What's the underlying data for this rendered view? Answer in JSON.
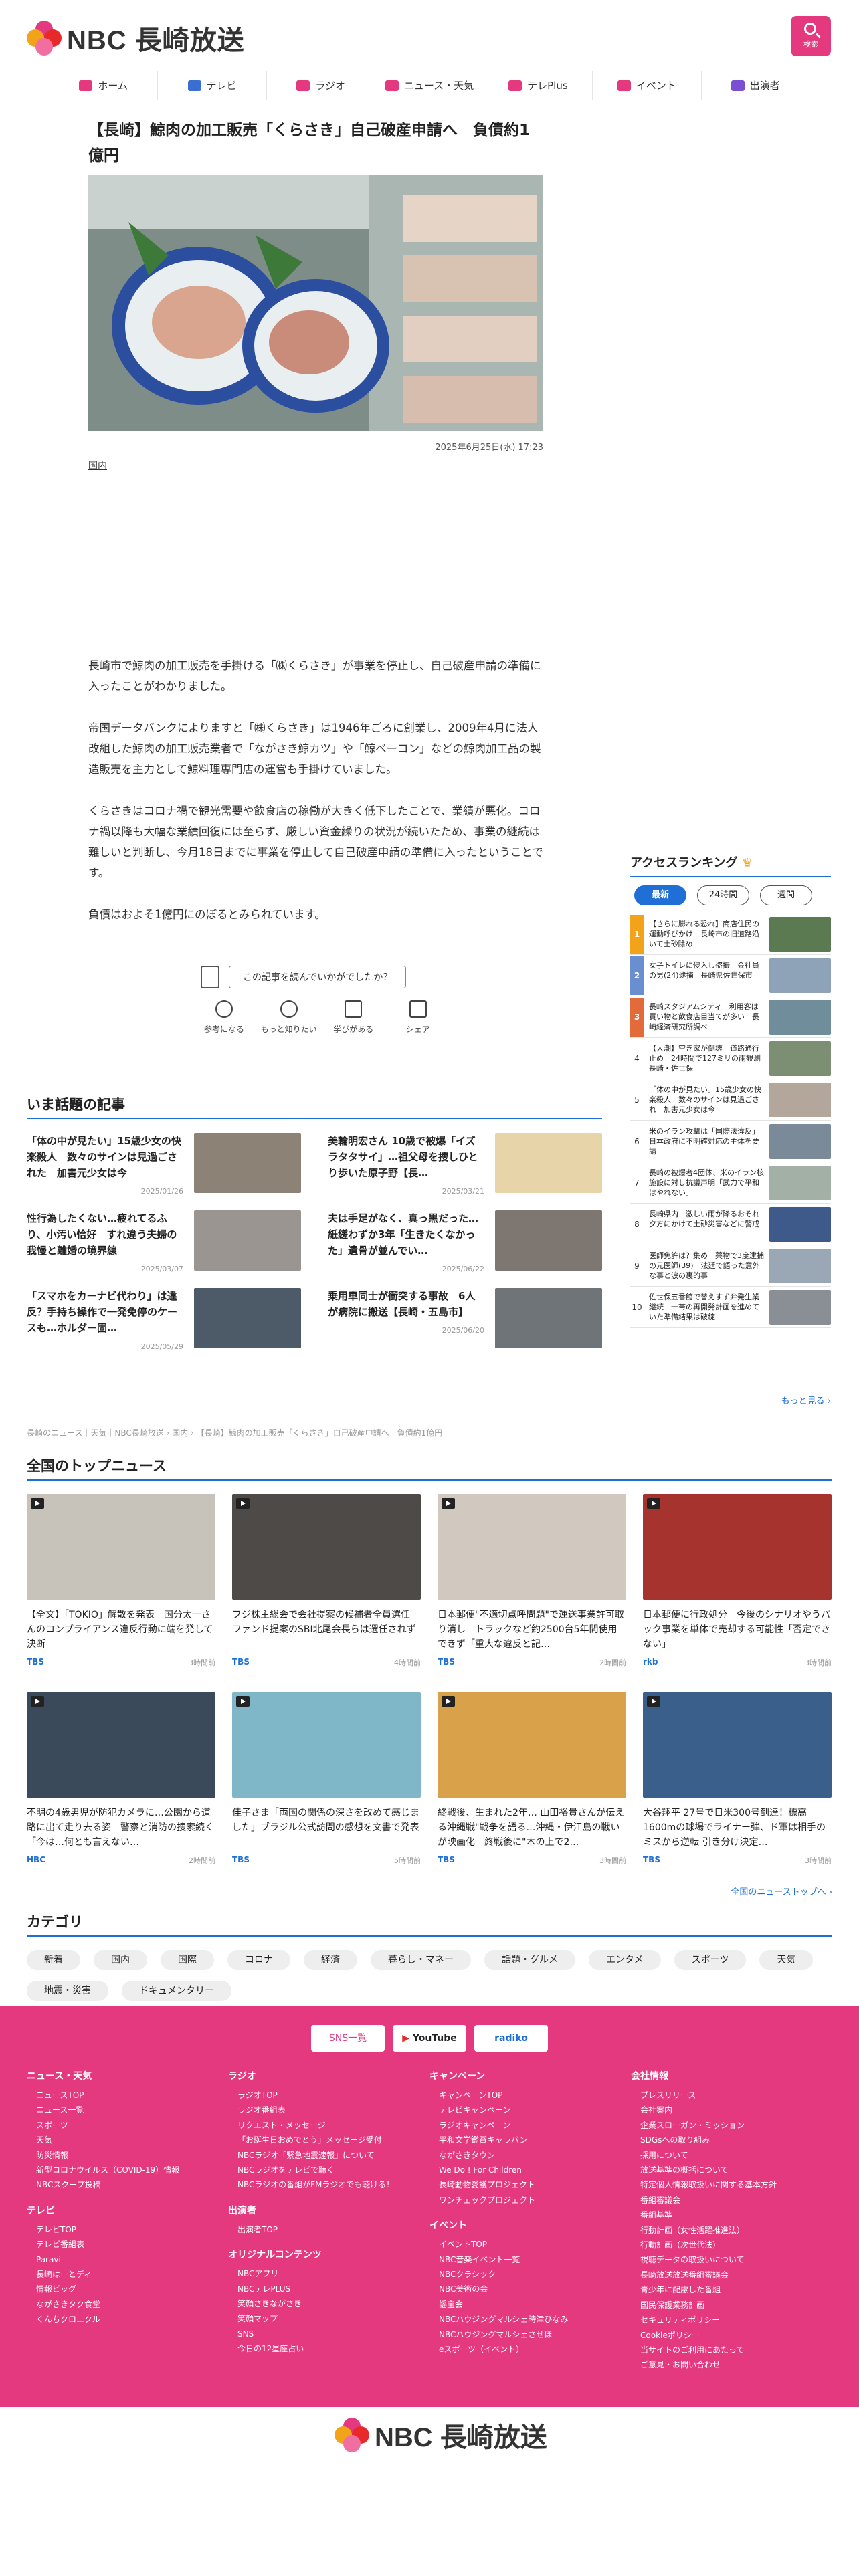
{
  "site": {
    "name": "NBC 長崎放送",
    "search_label": "検索"
  },
  "nav": [
    "ホーム",
    "テレビ",
    "ラジオ",
    "ニュース・天気",
    "テレPlus",
    "イベント",
    "出演者"
  ],
  "article": {
    "title": "【長崎】鯨肉の加工販売「くらさき」自己破産申請へ　負債約1億円",
    "date": "2025年6月25日(水) 17:23",
    "category": "国内",
    "paragraphs": [
      "長崎市で鯨肉の加工販売を手掛ける「㈱くらさき」が事業を停止し、自己破産申請の準備に入ったことがわかりました。",
      "帝国データバンクによりますと「㈱くらさき」は1946年ごろに創業し、2009年4月に法人改組した鯨肉の加工販売業者で「ながさき鯨カツ」や「鯨ベーコン」などの鯨肉加工品の製造販売を主力として鯨料理専門店の運営も手掛けていました。",
      "くらさきはコロナ禍で観光需要や飲食店の稼働が大きく低下したことで、業績が悪化。コロナ禍以降も大幅な業績回復には至らず、厳しい資金繰りの状況が続いたため、事業の継続は難しいと判断し、今月18日までに事業を停止して自己破産申請の準備に入ったということです。",
      "負債はおよそ1億円にのぼるとみられています。"
    ],
    "reaction_question": "この記事を読んでいかがでしたか？",
    "reactions": [
      "参考になる",
      "もっと知りたい",
      "学びがある",
      "シェア"
    ]
  },
  "ranking": {
    "title": "アクセスランキング",
    "tabs": [
      "最新",
      "24時間",
      "週間"
    ],
    "items": [
      {
        "n": "1",
        "text": "【さらに膨れる恐れ】商店住民の運動呼びかけ　長崎市の旧道路沿いて土砂除め"
      },
      {
        "n": "2",
        "text": "女子トイレに侵入し盗撮　会社員の男(24)逮捕　長崎県佐世保市"
      },
      {
        "n": "3",
        "text": "長崎スタジアムシティ　利用客は買い物と飲食店目当てが多い　長崎経済研究所調べ"
      },
      {
        "n": "4",
        "text": "【大潮】空き家が倒壊　道路通行止め　24時間で127ミリの雨観測　長崎・佐世保"
      },
      {
        "n": "5",
        "text": "「体の中が見たい」15歳少女の快楽殺人　数々のサインは見過ごされ　加害元少女は今"
      },
      {
        "n": "6",
        "text": "米のイラン攻撃は「国際法違反」日本政府に不明確対応の主体を要請"
      },
      {
        "n": "7",
        "text": "長崎の被爆者4団体、米のイラン核施設に対し抗議声明「武力で平和はやれない」"
      },
      {
        "n": "8",
        "text": "長崎県内　激しい雨が降るおそれ　夕方にかけて土砂災害などに警戒"
      },
      {
        "n": "9",
        "text": "医師免許は？集め　薬物で3度逮捕の元医師(39)　法廷で語った意外な事と涙の裏的事"
      },
      {
        "n": "10",
        "text": "佐世保五番館で替えすず弁発生業継続　一帯の再開発計画を進めていた準備結果は破綻"
      }
    ],
    "more": "もっと見る ›"
  },
  "popular": {
    "title": "いま話題の記事",
    "items": [
      {
        "title": "「体の中が見たい」15歳少女の快楽殺人　数々のサインは見過ごされた　加害元少女は今",
        "date": "2025/01/26"
      },
      {
        "title": "美輪明宏さん 10歳で被爆「イズラタタサイ」…祖父母を捜しひとり歩いた原子野【長…",
        "date": "2025/03/21"
      },
      {
        "title": "性行為したくない…疲れてるふり、小汚い恰好　すれ違う夫婦の我慢と離婚の境界線",
        "date": "2025/03/07"
      },
      {
        "title": "夫は手足がなく、真っ黒だった…紙縒わずか3年「生きたくなかった」遺骨が並んでい…",
        "date": "2025/06/22"
      },
      {
        "title": "「スマホをカーナビ代わり」は違反？手持ち操作で一発免停のケースも…ホルダー固…",
        "date": "2025/05/29"
      },
      {
        "title": "乗用車同士が衝突する事故　6人が病院に搬送【長崎・五島市】",
        "date": "2025/06/20"
      }
    ]
  },
  "breadcrumb": "長崎のニュース｜天気｜NBC長崎放送 › 国内 › 【長崎】鯨肉の加工販売「くらさき」自己破産申請へ　負債約1億円",
  "topnews": {
    "title": "全国のトップニュース",
    "items": [
      {
        "title": "【全文】「TOKIO」解散を発表　国分太一さんのコンプライアンス違反行動に端を発して決断",
        "src": "TBS",
        "time": "3時間前"
      },
      {
        "title": "フジ株主総会で会社提案の候補者全員選任　ファンド提案のSBI北尾会長らは選任されず",
        "src": "TBS",
        "time": "4時間前"
      },
      {
        "title": "日本郵便\"不適切点呼問題\"で運送事業許可取り消し　トラックなど約2500台5年間使用できず「重大な違反と記…",
        "src": "TBS",
        "time": "2時間前"
      },
      {
        "title": "日本郵便に行政処分　今後のシナリオやうパック事業を単体で売却する可能性「否定できない」",
        "src": "rkb",
        "time": "3時間前"
      },
      {
        "title": "不明の4歳男児が防犯カメラに…公園から道路に出て走り去る姿　警察と消防の捜索続く「今は…何とも言えない…",
        "src": "HBC",
        "time": "2時間前"
      },
      {
        "title": "佳子さま「両国の関係の深さを改めて感じました」ブラジル公式訪問の感想を文書で発表",
        "src": "TBS",
        "time": "5時間前"
      },
      {
        "title": "終戦後、生まれた2年… 山田裕貴さんが伝える沖縄戦\"戦争を語る…沖縄・伊江島の戦いが映画化　終戦後に\"木の上で2…",
        "src": "TBS",
        "time": "3時間前"
      },
      {
        "title": "大谷翔平 27号で日米300号到達！標高1600mの球場でライナー弾、ド軍は相手のミスから逆転 引き分け決定…",
        "src": "TBS",
        "time": "3時間前"
      }
    ],
    "all_link": "全国のニューストップへ ›"
  },
  "categories": {
    "title": "カテゴリ",
    "items": [
      "新着",
      "国内",
      "国際",
      "コロナ",
      "経済",
      "暮らし・マネー",
      "話題・グルメ",
      "エンタメ",
      "スポーツ",
      "天気",
      "地震・災害",
      "ドキュメンタリー"
    ]
  },
  "footer_buttons": [
    "SNS一覧",
    "YouTube",
    "radiko"
  ],
  "footer": {
    "cols": [
      [
        {
          "h": "ニュース・天気",
          "items": [
            "ニュースTOP",
            "ニュース一覧",
            "スポーツ",
            "天気",
            "防災情報",
            "新型コロナウイルス（COVID-19）情報",
            "NBCスクープ投稿"
          ]
        },
        {
          "h": "テレビ",
          "items": [
            "テレビTOP",
            "テレビ番組表",
            "Paravi",
            "長崎はーとディ",
            "情報ビッグ",
            "ながさきタク食堂",
            "くんちクロニクル"
          ]
        }
      ],
      [
        {
          "h": "ラジオ",
          "items": [
            "ラジオTOP",
            "ラジオ番組表",
            "リクエスト・メッセージ",
            "「お誕生日おめでとう」メッセージ受付",
            "NBCラジオ「緊急地震速報」について",
            "NBCラジオをテレビで聴く",
            "NBCラジオの番組がFMラジオでも聴ける！"
          ]
        },
        {
          "h": "出演者",
          "items": [
            "出演者TOP"
          ]
        },
        {
          "h": "オリジナルコンテンツ",
          "items": [
            "NBCアプリ",
            "NBCテレPLUS",
            "笑顔さきながさき",
            "笑顔マップ",
            "SNS",
            "今日の12星座占い"
          ]
        }
      ],
      [
        {
          "h": "キャンペーン",
          "items": [
            "キャンペーンTOP",
            "テレビキャンペーン",
            "ラジオキャンペーン",
            "平和文学鑑賞キャラバン",
            "ながさきタウン",
            "We Do ! For Children",
            "長崎動物愛護プロジェクト",
            "ワンチェックプロジェクト"
          ]
        },
        {
          "h": "イベント",
          "items": [
            "イベントTOP",
            "NBC音楽イベント一覧",
            "NBCクラシック",
            "NBC美術の会",
            "謡宝会",
            "NBCハウジングマルシェ時津ひなみ",
            "NBCハウジングマルシェさせほ",
            "eスポーツ（イベント）"
          ]
        }
      ],
      [
        {
          "h": "会社情報",
          "items": [
            "プレスリリース",
            "会社案内",
            "企業スローガン・ミッション",
            "SDGsへの取り組み",
            "採用について",
            "放送基準の概括について",
            "特定個人情報取扱いに関する基本方針",
            "番組審議会",
            "番組基準",
            "行動計画（女性活躍推進法）",
            "行動計画（次世代法）",
            "視聴データの取扱いについて",
            "長崎放送放送番組審議会",
            "青少年に配慮した番組",
            "国民保護業務計画",
            "セキュリティポリシー",
            "Cookieポリシー",
            "当サイトのご利用にあたって",
            "ご意見・お問い合わせ"
          ]
        }
      ]
    ]
  }
}
